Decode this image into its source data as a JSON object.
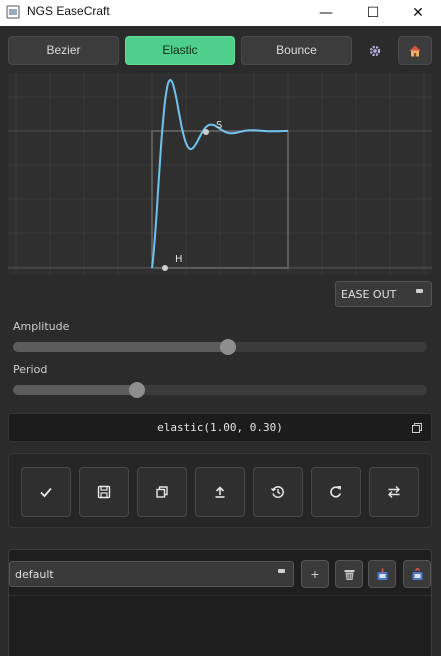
{
  "window": {
    "title": "NGS EaseCraft",
    "minimize_glyph": "—",
    "maximize_glyph": "☐",
    "close_glyph": "✕"
  },
  "modes": {
    "bezier": "Bezier",
    "elastic": "Elastic",
    "bounce": "Bounce",
    "active": "elastic"
  },
  "graph": {
    "start_handle_label": "H",
    "end_handle_label": "S",
    "curve_color": "#6fc3ee"
  },
  "ease_mode": {
    "selected": "EASE OUT"
  },
  "params": {
    "amplitude_label": "Amplitude",
    "amplitude_value": 0.52,
    "period_label": "Period",
    "period_value": 0.3
  },
  "expression": {
    "text": "elastic(1.00, 0.30)"
  },
  "toolbar": {
    "icons": [
      "check-icon",
      "save-icon",
      "duplicate-icon",
      "export-icon",
      "history-icon",
      "redo-icon",
      "swap-icon"
    ]
  },
  "presets": {
    "selected": "default",
    "add_label": "+"
  },
  "colors": {
    "accent": "#4fd08a",
    "background": "#2b2b2b"
  }
}
